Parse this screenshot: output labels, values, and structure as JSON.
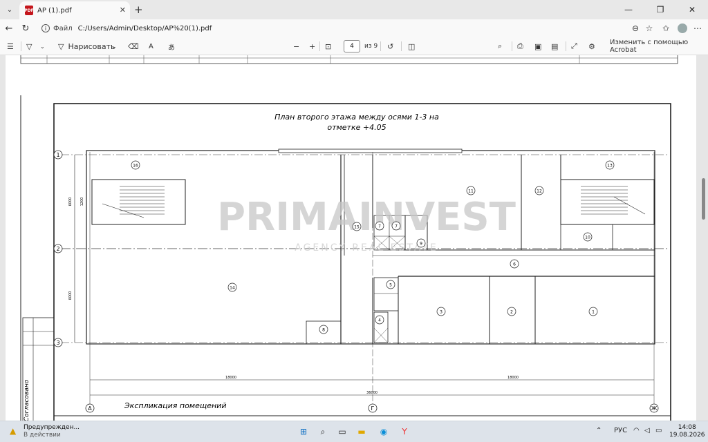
{
  "browser": {
    "tab_title": "AP (1).pdf",
    "url_label": "Файл",
    "url": "C:/Users/Admin/Desktop/AP%20(1).pdf"
  },
  "pdf_toolbar": {
    "draw_label": "Нарисовать",
    "page_current": "4",
    "page_total": "из 9",
    "edit_acrobat": "Изменить с помощью Acrobat"
  },
  "drawing": {
    "title_line1": "План второго этажа между осями 1-3 на",
    "title_line2": "отметке +4.05",
    "side_label": "Согласовано",
    "explication": "Экспликация помещений",
    "watermark_main": "PRIMAINVEST",
    "watermark_sub": "AGENCY REAL ESTATE",
    "rooms": [
      "1",
      "2",
      "3",
      "4",
      "5",
      "6",
      "7",
      "7",
      "8",
      "9",
      "10",
      "11",
      "12",
      "13",
      "14",
      "15",
      "16"
    ],
    "axis_rows": [
      "1",
      "2",
      "3"
    ],
    "axis_cols": [
      "А",
      "Г",
      "Ж"
    ],
    "dim_total": "36000",
    "dim_left": "18000",
    "dim_right": "18000",
    "dim_vert_1": "6000",
    "dim_vert_2": "6000",
    "dim_stair": "1200"
  },
  "taskbar": {
    "notif_title": "Предупрежден...",
    "notif_sub": "В действии",
    "lang": "РУС",
    "time": "14:08",
    "date": "19.08.2026"
  }
}
